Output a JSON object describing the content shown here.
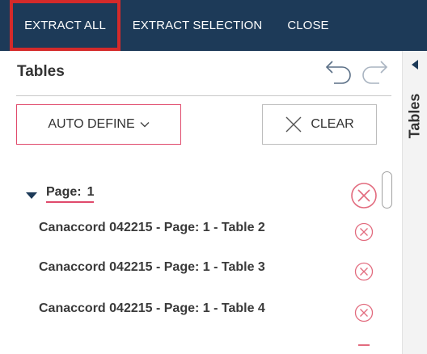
{
  "toolbar": {
    "extract_all": "EXTRACT ALL",
    "extract_selection": "EXTRACT SELECTION",
    "close": "CLOSE"
  },
  "panel": {
    "title": "Tables",
    "side_tab_label": "Tables",
    "undo_icon": "undo-icon",
    "redo_icon": "redo-icon"
  },
  "actions": {
    "auto_define": "AUTO DEFINE",
    "clear": "CLEAR"
  },
  "page_group": {
    "label": "Page:",
    "number": "1"
  },
  "tables": [
    {
      "label": "Canaccord 042215 - Page: 1 - Table 2"
    },
    {
      "label": "Canaccord 042215 - Page: 1 - Table 3"
    },
    {
      "label": "Canaccord 042215 - Page: 1 - Table 4"
    }
  ],
  "colors": {
    "toolbar_bg": "#1d3a58",
    "highlight_red": "#d42a2a",
    "accent_pink": "#e04a6c",
    "remove_icon": "#e26b7e"
  }
}
